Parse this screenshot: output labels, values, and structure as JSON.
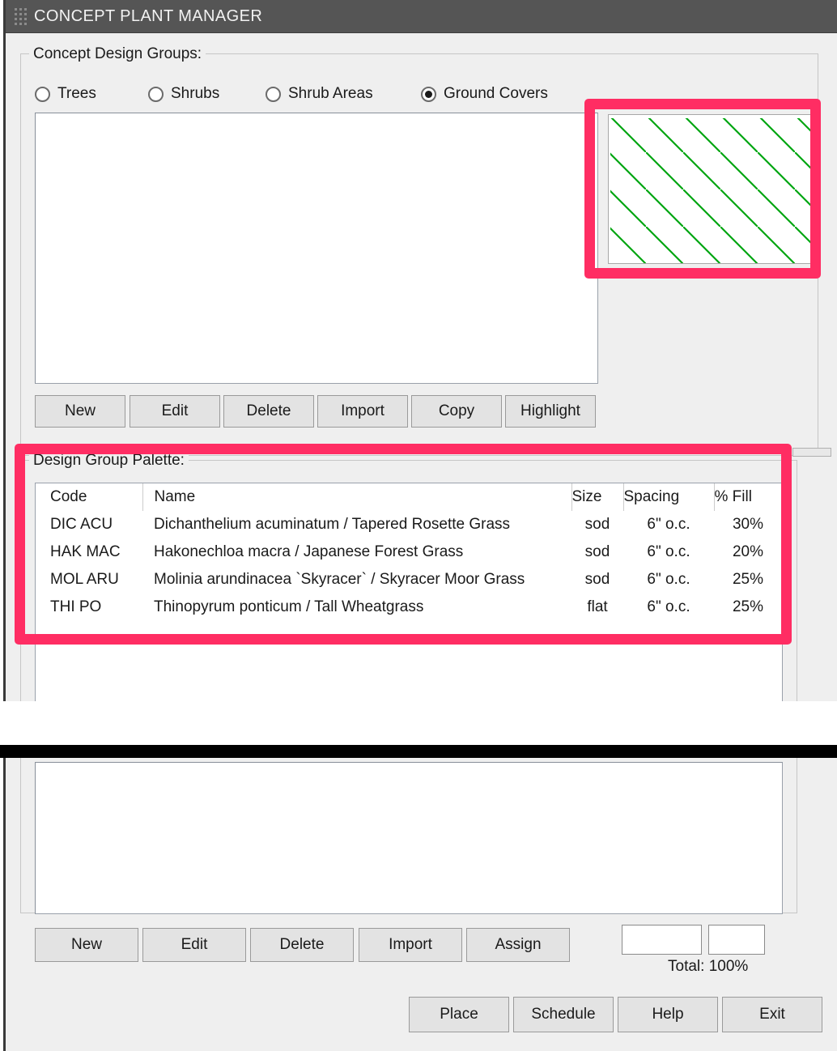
{
  "window": {
    "title": "CONCEPT PLANT MANAGER",
    "grip_icon": "drag-grip-icon"
  },
  "colors": {
    "titlebar": "#555555",
    "panel": "#efefef",
    "annotation_pink": "#ff2d63",
    "hatch_green": "#00a510",
    "button_face": "#e3e3e3"
  },
  "concept_groups": {
    "legend": "Concept Design Groups:",
    "radios": [
      {
        "label": "Trees",
        "selected": false
      },
      {
        "label": "Shrubs",
        "selected": false
      },
      {
        "label": "Shrub Areas",
        "selected": false
      },
      {
        "label": "Ground Covers",
        "selected": true
      }
    ],
    "list_items": [],
    "buttons": [
      "New",
      "Edit",
      "Delete",
      "Import",
      "Copy",
      "Highlight"
    ],
    "swatch": {
      "name": "hatch-pattern-preview",
      "pattern": "diagonal-lines",
      "color": "#00a510"
    }
  },
  "palette": {
    "legend": "Design Group Palette:",
    "columns": [
      "Code",
      "Name",
      "Size",
      "Spacing",
      "% Fill"
    ],
    "rows": [
      {
        "code": "DIC ACU",
        "name": "Dichanthelium acuminatum / Tapered Rosette Grass",
        "size": "sod",
        "spacing": "6\" o.c.",
        "fill": "30%"
      },
      {
        "code": "HAK MAC",
        "name": "Hakonechloa macra / Japanese Forest Grass",
        "size": "sod",
        "spacing": "6\" o.c.",
        "fill": "20%"
      },
      {
        "code": "MOL ARU",
        "name": "Molinia arundinacea `Skyracer` / Skyracer Moor Grass",
        "size": "sod",
        "spacing": "6\" o.c.",
        "fill": "25%"
      },
      {
        "code": "THI  PO",
        "name": "Thinopyrum  ponticum / Tall Wheatgrass",
        "size": "flat",
        "spacing": "6\" o.c.",
        "fill": "25%"
      }
    ]
  },
  "palette_actions": {
    "buttons": [
      "New",
      "Edit",
      "Delete",
      "Import",
      "Assign"
    ],
    "field_left": "",
    "field_right": "",
    "field_placeholder": "",
    "total_label": "Total: 100%"
  },
  "footer": {
    "buttons": [
      "Place",
      "Schedule",
      "Help",
      "Exit"
    ]
  }
}
